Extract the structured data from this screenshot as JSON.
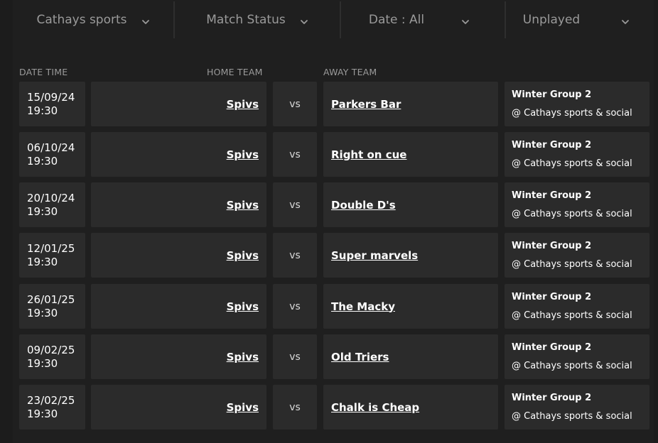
{
  "filters": [
    {
      "label": "Cathays sports",
      "icon": "chevron-down-icon"
    },
    {
      "label": "Match Status",
      "icon": "chevron-down-icon"
    },
    {
      "label": "Date : All",
      "icon": "chevron-down-icon"
    },
    {
      "label": "Unplayed",
      "icon": "chevron-down-icon"
    }
  ],
  "columns": {
    "date_time": "DATE TIME",
    "home_team": "HOME TEAM",
    "away_team": "AWAY TEAM"
  },
  "fixtures": [
    {
      "date": "15/09/24",
      "time": "19:30",
      "home": "Spivs",
      "vs": "vs",
      "away": "Parkers Bar",
      "group": "Winter Group 2",
      "venue": "@ Cathays sports & social"
    },
    {
      "date": "06/10/24",
      "time": "19:30",
      "home": "Spivs",
      "vs": "vs",
      "away": "Right on cue",
      "group": "Winter Group 2",
      "venue": "@ Cathays sports & social"
    },
    {
      "date": "20/10/24",
      "time": "19:30",
      "home": "Spivs",
      "vs": "vs",
      "away": "Double D's",
      "group": "Winter Group 2",
      "venue": "@ Cathays sports & social"
    },
    {
      "date": "12/01/25",
      "time": "19:30",
      "home": "Spivs",
      "vs": "vs",
      "away": "Super marvels",
      "group": "Winter Group 2",
      "venue": "@ Cathays sports & social"
    },
    {
      "date": "26/01/25",
      "time": "19:30",
      "home": "Spivs",
      "vs": "vs",
      "away": "The Macky",
      "group": "Winter Group 2",
      "venue": "@ Cathays sports & social"
    },
    {
      "date": "09/02/25",
      "time": "19:30",
      "home": "Spivs",
      "vs": "vs",
      "away": "Old Triers",
      "group": "Winter Group 2",
      "venue": "@ Cathays sports & social"
    },
    {
      "date": "23/02/25",
      "time": "19:30",
      "home": "Spivs",
      "vs": "vs",
      "away": "Chalk is Cheap",
      "group": "Winter Group 2",
      "venue": "@ Cathays sports & social"
    }
  ],
  "colors": {
    "background": "#1c1c1c",
    "panel": "#1f1f1f",
    "cell": "#2b2b2b",
    "muted_text": "#9a9a9a",
    "text": "#ffffff"
  }
}
